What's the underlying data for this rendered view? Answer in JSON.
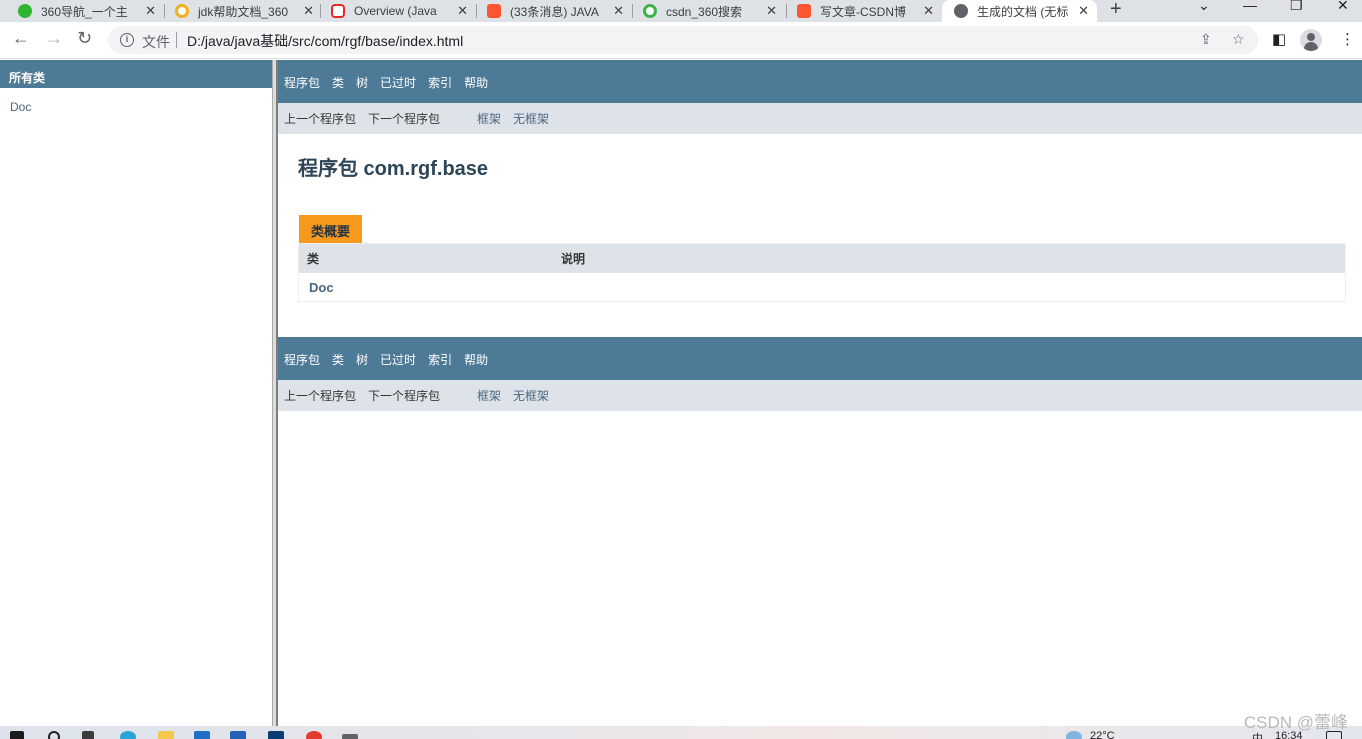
{
  "browser": {
    "tabs": [
      {
        "title": "360导航_一个主",
        "icon_color": "#2fb62f"
      },
      {
        "title": "jdk帮助文档_360",
        "icon_color": "#f2b11a"
      },
      {
        "title": "Overview (Java",
        "icon_color": "#e22b2b"
      },
      {
        "title": "(33条消息) JAVA",
        "icon_color": "#fc5531"
      },
      {
        "title": "csdn_360搜索",
        "icon_color": "#3bb34a"
      },
      {
        "title": "写文章-CSDN博",
        "icon_color": "#fc5531"
      },
      {
        "title": "生成的文档 (无标",
        "icon_color": "#5f6368",
        "active": true
      }
    ],
    "address": {
      "scheme_label": "文件",
      "url": "D:/java/java基础/src/com/rgf/base/index.html"
    }
  },
  "left_frame": {
    "heading": "所有类",
    "classes": [
      "Doc"
    ]
  },
  "doc": {
    "top_nav": [
      "程序包",
      "类",
      "树",
      "已过时",
      "索引",
      "帮助"
    ],
    "sub_nav": {
      "prev_package": "上一个程序包",
      "next_package": "下一个程序包",
      "frames": "框架",
      "no_frames": "无框架"
    },
    "package_title": "程序包 com.rgf.base",
    "summary": {
      "caption": "类概要",
      "col_class": "类",
      "col_desc": "说明",
      "rows": [
        {
          "name": "Doc",
          "desc": ""
        }
      ]
    }
  },
  "taskbar": {
    "weather": "22°C",
    "ime": "中",
    "time": "16:34"
  },
  "watermark": "CSDN @蕾峰",
  "colors": {
    "nav_bar": "#4d7a97",
    "sub_nav": "#dee3e9",
    "caption": "#f8981d",
    "link": "#4a6782"
  }
}
